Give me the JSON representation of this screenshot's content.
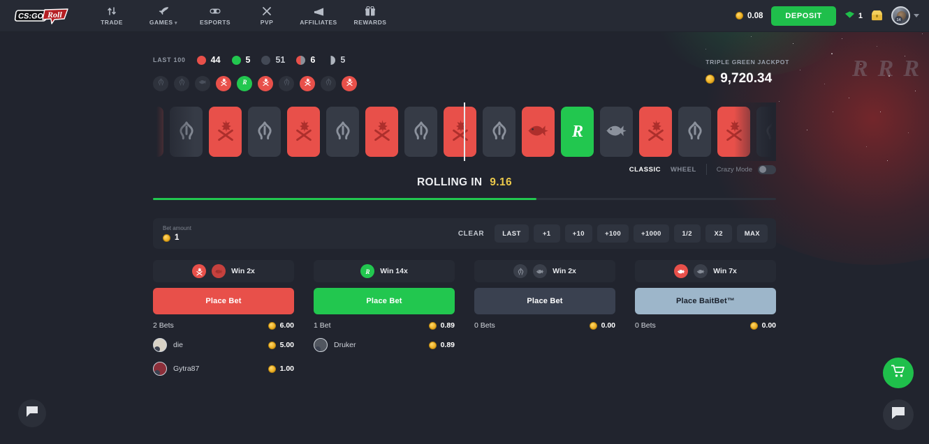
{
  "header": {
    "logo_text_1": "CS:GO",
    "logo_text_2": "Roll",
    "nav": [
      {
        "label": "TRADE",
        "icon": "trade-arrows-icon",
        "caret": false
      },
      {
        "label": "GAMES",
        "icon": "rocket-icon",
        "caret": true
      },
      {
        "label": "ESPORTS",
        "icon": "gamepad-icon",
        "caret": false
      },
      {
        "label": "PVP",
        "icon": "swords-x-icon",
        "caret": false
      },
      {
        "label": "AFFILIATES",
        "icon": "megaphone-icon",
        "caret": false
      },
      {
        "label": "REWARDS",
        "icon": "gift-icon",
        "caret": false
      }
    ],
    "balance": "0.08",
    "deposit_label": "DEPOSIT",
    "gem_count": "1",
    "avatar_level": "14",
    "coin_color": "#f0b429",
    "deposit_color": "#1fbf4b"
  },
  "stats": {
    "label": "LAST 100",
    "items": [
      {
        "color": "red",
        "value": "44"
      },
      {
        "color": "green",
        "value": "5"
      },
      {
        "color": "gray",
        "value": "51"
      },
      {
        "color": "half-rg",
        "value": "6"
      },
      {
        "color": "half-b",
        "value": "5"
      }
    ]
  },
  "history": [
    {
      "color": "gray",
      "icon": "ct-icon"
    },
    {
      "color": "gray",
      "icon": "ct-icon"
    },
    {
      "color": "gray",
      "icon": "bait-fish-icon"
    },
    {
      "color": "red",
      "icon": "t-icon"
    },
    {
      "color": "green",
      "icon": "roll-r-icon"
    },
    {
      "color": "red",
      "icon": "t-icon"
    },
    {
      "color": "gray",
      "icon": "ct-icon"
    },
    {
      "color": "red",
      "icon": "t-icon"
    },
    {
      "color": "gray",
      "icon": "ct-icon"
    },
    {
      "color": "red",
      "icon": "t-icon"
    }
  ],
  "jackpot": {
    "label": "TRIPLE GREEN JACKPOT",
    "amount": "9,720.34",
    "decor": [
      "R",
      "R",
      "R"
    ]
  },
  "roller": {
    "tiles": [
      {
        "color": "red",
        "icon": "t-icon"
      },
      {
        "color": "gray",
        "icon": "ct-icon"
      },
      {
        "color": "red",
        "icon": "t-icon"
      },
      {
        "color": "gray",
        "icon": "ct-icon"
      },
      {
        "color": "red",
        "icon": "t-icon"
      },
      {
        "color": "gray",
        "icon": "ct-icon"
      },
      {
        "color": "red",
        "icon": "t-icon"
      },
      {
        "color": "gray",
        "icon": "ct-icon"
      },
      {
        "color": "red",
        "icon": "t-icon"
      },
      {
        "color": "gray",
        "icon": "ct-icon"
      },
      {
        "color": "red",
        "icon": "bait-fish-icon"
      },
      {
        "color": "green",
        "icon": "roll-r-icon"
      },
      {
        "color": "gray",
        "icon": "bait-fish-icon"
      },
      {
        "color": "red",
        "icon": "t-icon"
      },
      {
        "color": "gray",
        "icon": "ct-icon"
      },
      {
        "color": "red",
        "icon": "t-icon"
      },
      {
        "color": "gray",
        "icon": "ct-icon"
      },
      {
        "color": "red",
        "icon": "t-icon"
      },
      {
        "color": "gray",
        "icon": "ct-icon"
      }
    ],
    "selected_index": 11
  },
  "timer": {
    "rolling_label": "ROLLING IN",
    "seconds": "9.16",
    "progress_percent": 61.5,
    "progress_color": "#22c74f"
  },
  "modes": {
    "tabs": [
      {
        "label": "CLASSIC",
        "active": true
      },
      {
        "label": "WHEEL",
        "active": false
      }
    ],
    "crazy_label": "Crazy Mode",
    "crazy_on": false
  },
  "betbar": {
    "amount_label": "Bet amount",
    "amount_value": "1",
    "amount_placeholder": "0",
    "clear_label": "CLEAR",
    "chips": [
      "LAST",
      "+1",
      "+10",
      "+100",
      "+1000",
      "1/2",
      "X2",
      "MAX"
    ]
  },
  "columns": [
    {
      "icons": [
        {
          "type": "t-icon",
          "style": "red"
        },
        {
          "type": "bait-fish-icon",
          "style": "redfade"
        }
      ],
      "multiplier": "Win 2x",
      "button_label": "Place Bet",
      "button_style": "red",
      "bets_count": "2 Bets",
      "total": "6.00",
      "players": [
        {
          "name": "die",
          "amount": "5.00",
          "avatar_color": "#d8d2c6"
        },
        {
          "name": "Gytra87",
          "amount": "1.00",
          "avatar_color": "#8c2f3a"
        }
      ]
    },
    {
      "icons": [
        {
          "type": "roll-r-icon",
          "style": "green"
        }
      ],
      "multiplier": "Win 14x",
      "button_label": "Place Bet",
      "button_style": "green",
      "bets_count": "1 Bet",
      "total": "0.89",
      "players": [
        {
          "name": "Druker",
          "amount": "0.89",
          "avatar_color": "#51565f"
        }
      ]
    },
    {
      "icons": [
        {
          "type": "ct-icon",
          "style": "gray"
        },
        {
          "type": "bait-fish-icon",
          "style": "gray"
        }
      ],
      "multiplier": "Win 2x",
      "button_label": "Place Bet",
      "button_style": "gray",
      "bets_count": "0 Bets",
      "total": "0.00",
      "players": []
    },
    {
      "icons": [
        {
          "type": "bait-fish-icon",
          "style": "red"
        },
        {
          "type": "bait-fish-icon",
          "style": "gray"
        }
      ],
      "multiplier": "Win 7x",
      "button_label": "Place BaitBet™",
      "button_style": "blue",
      "bets_count": "0 Bets",
      "total": "0.00",
      "players": []
    }
  ],
  "floating": {
    "cart_icon": "shopping-cart-icon",
    "chat_right_icon": "chat-bubble-icon",
    "chat_left_icon": "chat-bubble-icon"
  }
}
